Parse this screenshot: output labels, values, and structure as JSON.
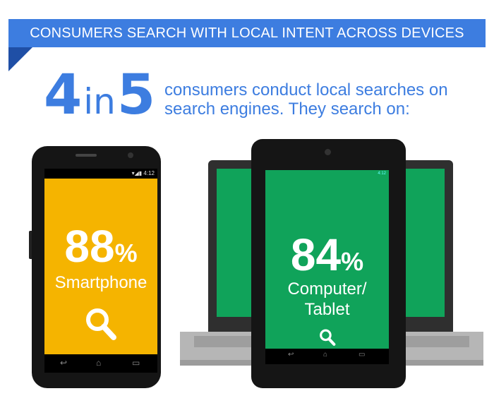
{
  "banner": {
    "text": "CONSUMERS SEARCH WITH LOCAL INTENT ACROSS DEVICES"
  },
  "headline": {
    "big_num1": "4",
    "big_in": "in",
    "big_num2": "5",
    "text": "consumers conduct local searches on search engines. They search on:"
  },
  "phone": {
    "status_time": "4:12",
    "percent": "88",
    "percent_sign": "%",
    "label": "Smartphone",
    "nav": [
      "↩",
      "⌂",
      "▭"
    ],
    "icon": "search-icon"
  },
  "tablet": {
    "status_time": "4:12",
    "percent": "84",
    "percent_sign": "%",
    "label_line1": "Computer/",
    "label_line2": "Tablet",
    "nav": [
      "↩",
      "⌂",
      "▭"
    ],
    "icon": "search-icon"
  },
  "colors": {
    "brand_blue": "#3d7de0",
    "smartphone_yellow": "#f5b400",
    "computer_green": "#10a35a"
  }
}
